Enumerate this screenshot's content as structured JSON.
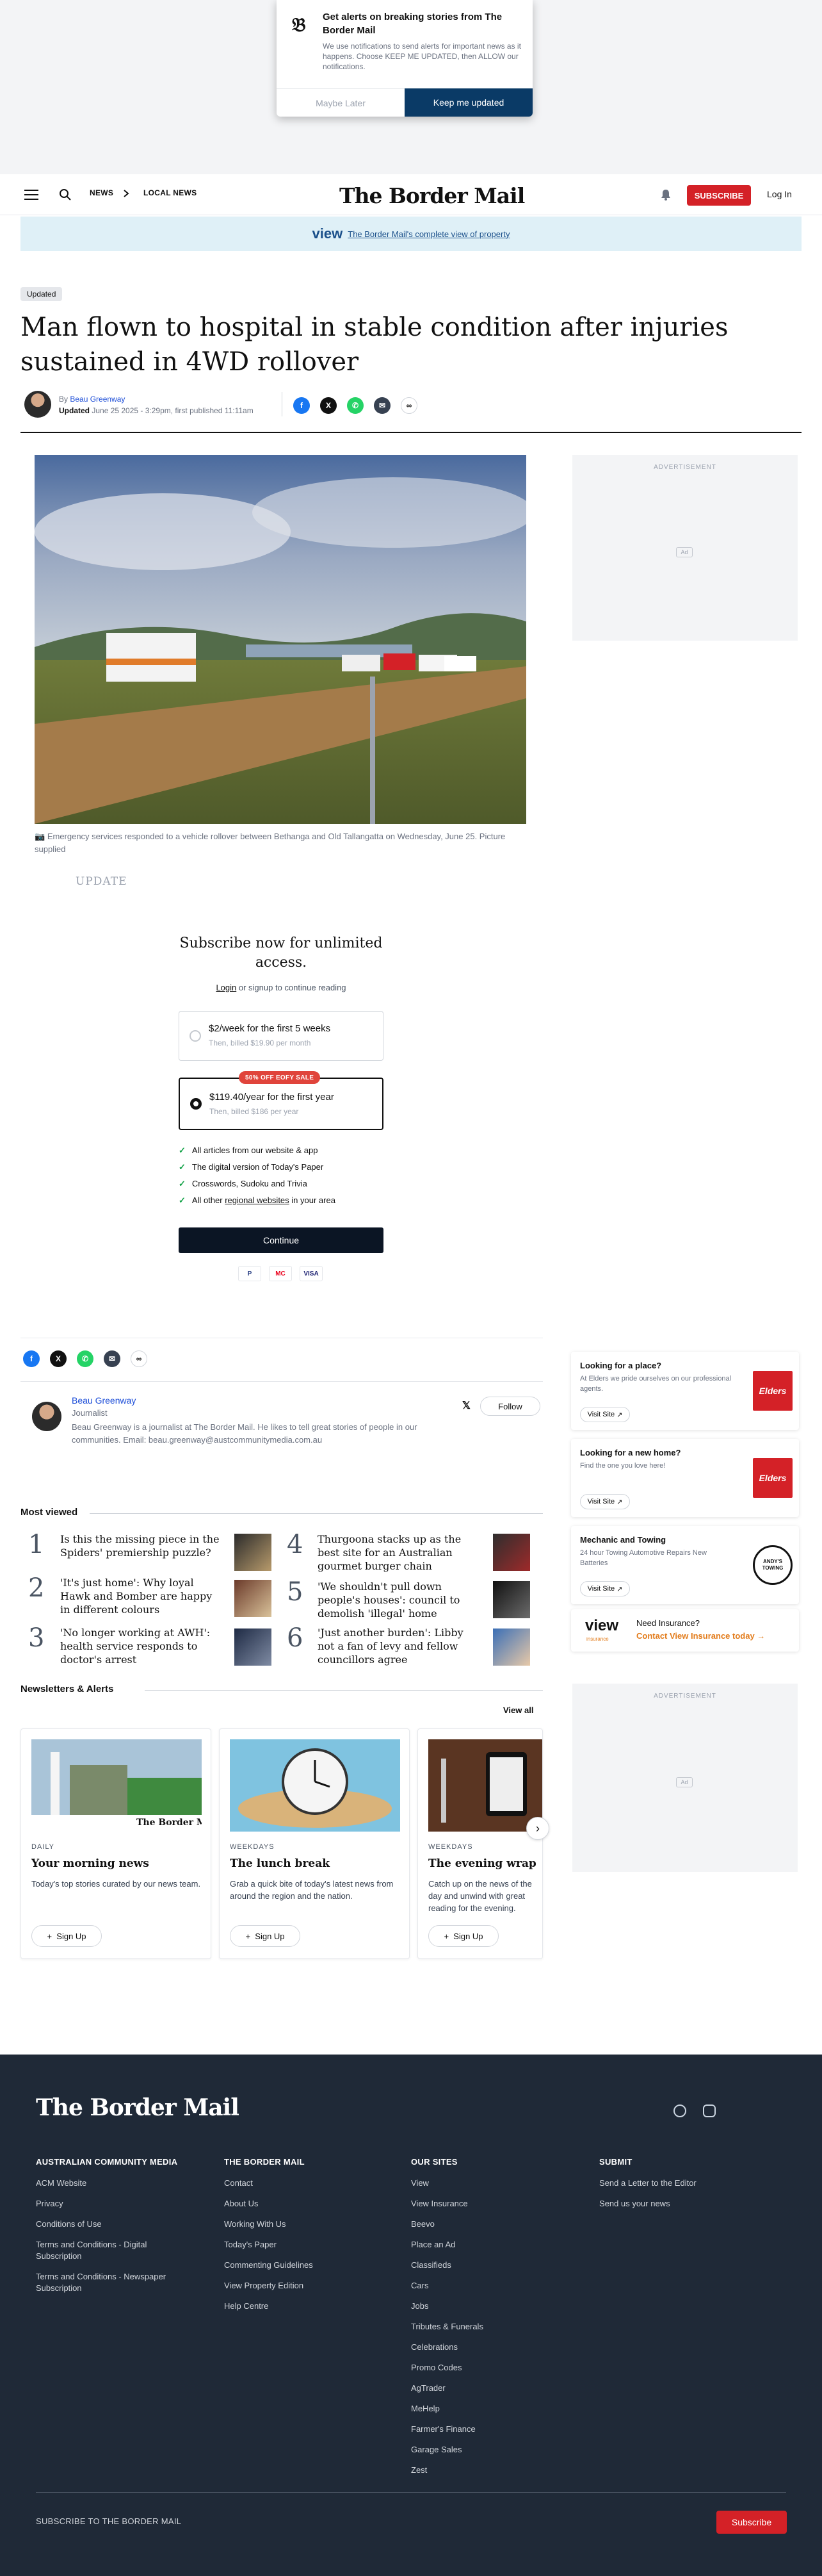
{
  "notification": {
    "title": "Get alerts on breaking stories from The Border Mail",
    "body": "We use notifications to send alerts for important news as it happens. Choose KEEP ME UPDATED, then ALLOW our notifications.",
    "later_label": "Maybe Later",
    "keep_label": "Keep me updated"
  },
  "header": {
    "breadcrumbs": [
      "NEWS",
      "LOCAL NEWS"
    ],
    "logo": "The Border Mail",
    "subscribe_label": "SUBSCRIBE",
    "login_label": "Log In"
  },
  "banner": {
    "brand": "view",
    "text": "The Border Mail's complete view of property"
  },
  "article": {
    "tag": "Updated",
    "headline": "Man flown to hospital in stable condition after injuries sustained in 4WD rollover",
    "by_prefix": "By",
    "author": "Beau Greenway",
    "updated_label": "Updated",
    "updated_text": "June 25 2025 - 3:29pm, first published 11:11am",
    "caption": "Emergency services responded to a vehicle rollover between Bethanga and Old Tallangatta on Wednesday, June 25. Picture supplied",
    "update_word": "UPDATE"
  },
  "ads": {
    "label": "ADVERTISEMENT",
    "mark": "Ad"
  },
  "paywall": {
    "title": "Subscribe now for unlimited access.",
    "login_link": "Login",
    "login_rest": " or signup to continue reading",
    "plans": [
      {
        "title": "$2/week for the first 5 weeks",
        "sub": "Then, billed $19.90 per month",
        "selected": false
      },
      {
        "title": "$119.40/year for the first year",
        "sub": "Then, billed $186 per year",
        "selected": true,
        "badge": "50% OFF EOFY SALE"
      }
    ],
    "benefits": [
      "All articles from our website & app",
      "The digital version of Today's Paper",
      "Crosswords, Sudoku and Trivia"
    ],
    "benefit_last_pre": "All other ",
    "benefit_last_link": "regional websites",
    "benefit_last_post": " in your area",
    "continue_label": "Continue",
    "payments": [
      "P",
      "MC",
      "VISA"
    ]
  },
  "author_card": {
    "name": "Beau Greenway",
    "role": "Journalist",
    "bio": "Beau Greenway is a journalist at The Border Mail. He likes to tell great stories of people in our communities. Email: beau.greenway@austcommunitymedia.com.au",
    "follow_label": "Follow"
  },
  "right_ads": [
    {
      "title": "Looking for a place?",
      "desc": "At Elders we pride ourselves on our professional agents.",
      "visit": "Visit Site",
      "logo": "Elders"
    },
    {
      "title": "Looking for a new home?",
      "desc": "Find the one you love here!",
      "visit": "Visit Site",
      "logo": "Elders"
    },
    {
      "title": "Mechanic and Towing",
      "desc": "24 hour Towing Automotive Repairs New Batteries",
      "visit": "Visit Site",
      "logo": "ANDY'S TOWING"
    }
  ],
  "view_insurance": {
    "brand": "view",
    "brand_sub": "insurance",
    "question": "Need Insurance?",
    "link": "Contact View Insurance today"
  },
  "most_viewed": {
    "title": "Most viewed",
    "items": [
      {
        "num": "1",
        "title": "Is this the missing piece in the Spiders' premiership puzzle?"
      },
      {
        "num": "2",
        "title": "'It's just home': Why loyal Hawk and Bomber are happy in different colours"
      },
      {
        "num": "3",
        "title": "'No longer working at AWH': health service responds to doctor's arrest"
      },
      {
        "num": "4",
        "title": "Thurgoona stacks up as the best site for an Australian gourmet burger chain"
      },
      {
        "num": "5",
        "title": "'We shouldn't pull down people's houses': council to demolish 'illegal' home"
      },
      {
        "num": "6",
        "title": "'Just another burden': Libby not a fan of levy and fellow councillors agree"
      }
    ]
  },
  "newsletters": {
    "title": "Newsletters & Alerts",
    "view_all": "View all",
    "items": [
      {
        "freq": "DAILY",
        "title": "Your morning news",
        "desc": "Today's top stories curated by our news team.",
        "button": "Sign Up",
        "img_logo": "The Border Mail"
      },
      {
        "freq": "WEEKDAYS",
        "title": "The lunch break",
        "desc": "Grab a quick bite of today's latest news from around the region and the nation.",
        "button": "Sign Up"
      },
      {
        "freq": "WEEKDAYS",
        "title": "The evening wrap",
        "desc": "Catch up on the news of the day and unwind with great reading for the evening.",
        "button": "Sign Up"
      }
    ]
  },
  "footer": {
    "logo": "The Border Mail",
    "columns": [
      {
        "title": "AUSTRALIAN COMMUNITY MEDIA",
        "links": [
          "ACM Website",
          "Privacy",
          "Conditions of Use",
          "Terms and Conditions - Digital Subscription",
          "Terms and Conditions - Newspaper Subscription"
        ]
      },
      {
        "title": "THE BORDER MAIL",
        "links": [
          "Contact",
          "About Us",
          "Working With Us",
          "Today's Paper",
          "Commenting Guidelines",
          "View Property Edition",
          "Help Centre"
        ]
      },
      {
        "title": "OUR SITES",
        "links": [
          "View",
          "View Insurance",
          "Beevo",
          "Place an Ad",
          "Classifieds",
          "Cars",
          "Jobs",
          "Tributes & Funerals",
          "Celebrations",
          "Promo Codes",
          "AgTrader",
          "MeHelp",
          "Farmer's Finance",
          "Garage Sales",
          "Zest"
        ]
      },
      {
        "title": "SUBMIT",
        "links": [
          "Send a Letter to the Editor",
          "Send us your news"
        ]
      }
    ],
    "subscribe_text": "SUBSCRIBE TO THE BORDER MAIL",
    "subscribe_label": "Subscribe"
  }
}
